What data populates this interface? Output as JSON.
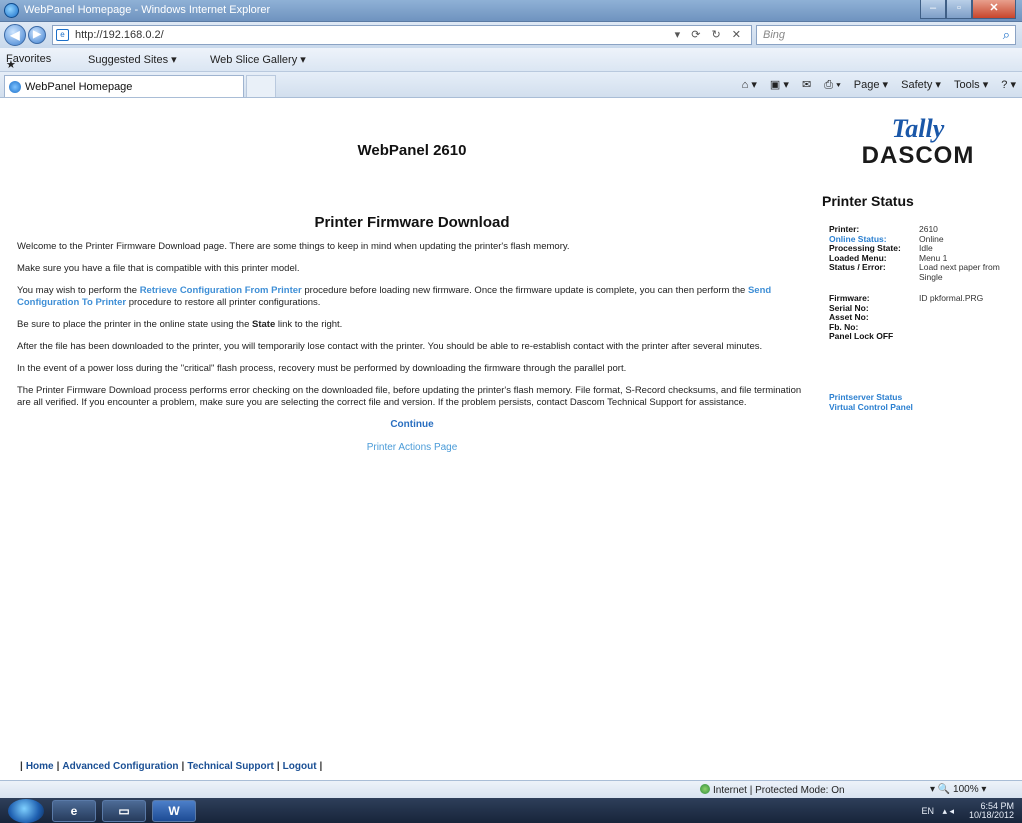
{
  "window": {
    "title": "WebPanel Homepage - Windows Internet Explorer",
    "url": "http://192.168.0.2/",
    "search_placeholder": "Bing",
    "favorites_label": "Favorites",
    "suggested_sites": "Suggested Sites ▾",
    "web_slice": "Web Slice Gallery ▾",
    "tab_title": "WebPanel Homepage",
    "cmd_page": "Page ▾",
    "cmd_safety": "Safety ▾",
    "cmd_tools": "Tools ▾"
  },
  "page": {
    "site_title": "WebPanel 2610",
    "heading": "Printer Firmware Download",
    "p1": "Welcome to the Printer Firmware Download page. There are some things to keep in mind when updating the printer's flash memory.",
    "p2": "Make sure you have a file that is compatible with this printer model.",
    "p3_a": "You may wish to perform the ",
    "p3_link1": "Retrieve Configuration From Printer",
    "p3_b": " procedure before loading new firmware. Once the firmware update is complete, you can then perform the ",
    "p3_link2": "Send Configuration To Printer",
    "p3_c": " procedure to restore all printer configurations.",
    "p4_a": "Be sure to place the printer in the online state using the ",
    "p4_bold": "State",
    "p4_b": " link to the right.",
    "p5": "After the file has been downloaded to the printer, you will temporarily lose contact with the printer. You should be able to re-establish contact with the printer after several minutes.",
    "p6": "In the event of a power loss during the \"critical\" flash process, recovery must be performed by downloading the firmware through the parallel port.",
    "p7": "The Printer Firmware Download process performs error checking on the downloaded file, before updating the printer's flash memory. File format, S-Record checksums, and file termination are all verified. If you encounter a problem, make sure you are selecting the correct file and version. If the problem persists, contact Dascom Technical Support for assistance.",
    "continue": "Continue",
    "printer_actions": "Printer Actions Page"
  },
  "sidebar": {
    "logo_top": "Tally",
    "logo_bottom": "DASCOM",
    "status_title": "Printer Status",
    "rows": [
      {
        "k": "Printer:",
        "v": "2610"
      },
      {
        "k": "Online Status:",
        "v": "Online"
      },
      {
        "k": "Processing State:",
        "v": "Idle"
      },
      {
        "k": "Loaded Menu:",
        "v": "Menu 1"
      },
      {
        "k": "Status / Error:",
        "v": "Load next paper from Single"
      },
      {
        "k": "Firmware:",
        "v": "ID pkformal.PRG"
      },
      {
        "k": "Serial No:",
        "v": ""
      },
      {
        "k": "Asset No:",
        "v": ""
      },
      {
        "k": "Fb. No:",
        "v": ""
      },
      {
        "k": "Panel Lock OFF",
        "v": ""
      }
    ],
    "link_printserver": "Printserver Status",
    "link_vcp": "Virtual Control Panel"
  },
  "footer": {
    "home": "Home",
    "advanced": "Advanced Configuration",
    "support": "Technical Support",
    "logout": "Logout"
  },
  "statusbar": {
    "zone": "Internet | Protected Mode: On",
    "zoom": "100%"
  },
  "taskbar": {
    "lang": "EN",
    "time": "6:54 PM",
    "date": "10/18/2012"
  }
}
